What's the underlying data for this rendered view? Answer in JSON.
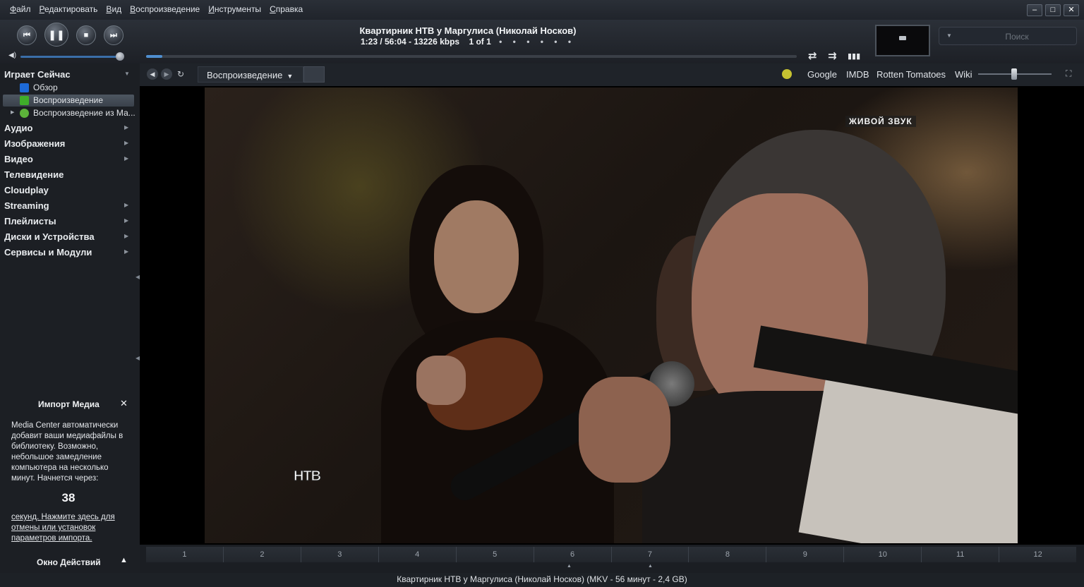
{
  "menu": [
    "Файл",
    "Редактировать",
    "Вид",
    "Воспроизведение",
    "Инструменты",
    "Справка"
  ],
  "window_buttons": {
    "minimize": "–",
    "maximize": "□",
    "close": "✕"
  },
  "transport": {
    "prev": "⏮",
    "pause": "❚❚",
    "stop": "■",
    "next": "⏭"
  },
  "now_playing": {
    "title": "Квартирник НТВ у Маргулиса (Николай Носков)",
    "time": "1:23 / 56:04",
    "bitrate": "13226 kbps",
    "position": "1 of 1",
    "dots": "• • • • • •",
    "progress_fraction": 0.025
  },
  "volume_fraction": 0.95,
  "playback_icons": {
    "repeat": "⇄",
    "shuffle": "⇉",
    "equalizer": "▮▮▮"
  },
  "search": {
    "placeholder": "Поиск"
  },
  "sidebar": {
    "now_playing_header": "Играет Сейчас",
    "now_playing_items": [
      {
        "label": "Обзор",
        "icon": "blue-play-icon",
        "color": "#1d6ad8"
      },
      {
        "label": "Воспроизведение",
        "icon": "green-play-icon",
        "color": "#3fae2a"
      },
      {
        "label": "Воспроизведение из Ма...",
        "icon": "green-network-icon",
        "color": "#5cb33a"
      }
    ],
    "sections": [
      "Аудио",
      "Изображения",
      "Видео",
      "Телевидение",
      "Cloudplay",
      "Streaming",
      "Плейлисты",
      "Диски и Устройства",
      "Сервисы и Модули"
    ],
    "sections_with_arrow": [
      true,
      true,
      true,
      false,
      false,
      true,
      true,
      true,
      true
    ]
  },
  "import": {
    "title": "Импорт Медиа",
    "close": "✕",
    "text": "Media Center автоматически добавит ваши медиафайлы в библиотеку. Возможно, небольшое замедление компьютера на несколько минут. Начнется через:",
    "countdown": "38",
    "link": "секунд. Нажмите здесь для отмены или установок параметров импорта."
  },
  "action_window": {
    "title": "Окно Действий",
    "toggle": "▲"
  },
  "content_bar": {
    "view_label": "Воспроизведение",
    "links": [
      "Google",
      "IMDB",
      "Rotten Tomatoes",
      "Wiki"
    ],
    "status_color": "#c6c231",
    "zoom_fraction": 0.45
  },
  "video": {
    "badge": "ЖИВОЙ ЗВУК",
    "channel_logo": "НТВ"
  },
  "chapters": [
    "1",
    "2",
    "3",
    "4",
    "5",
    "6",
    "7",
    "8",
    "9",
    "10",
    "11",
    "12"
  ],
  "status_bar": "Квартирник НТВ у Маргулиса (Николай Носков) (MKV - 56 минут - 2,4 GB)"
}
